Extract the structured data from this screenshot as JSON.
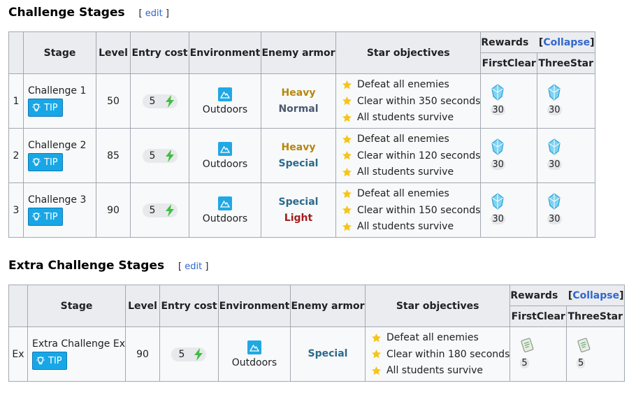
{
  "section1": {
    "title": "Challenge Stages",
    "edit_open": "[",
    "edit_label": "edit",
    "edit_close": "]",
    "headers": {
      "stage": "Stage",
      "level": "Level",
      "entry_cost": "Entry cost",
      "environment": "Environment",
      "enemy_armor": "Enemy armor",
      "star_objectives": "Star objectives",
      "rewards": "Rewards",
      "collapse_open": "[",
      "collapse": "Collapse",
      "collapse_close": "]",
      "first_clear": "FirstClear",
      "three_star": "ThreeStar"
    },
    "rows": [
      {
        "num": "1",
        "name": "Challenge 1",
        "tip": "TIP",
        "level": "50",
        "cost": "5",
        "environment": "Outdoors",
        "armor1": "Heavy",
        "armor2": "Normal",
        "objectives": [
          "Defeat all enemies",
          "Clear within 350 seconds",
          "All students survive"
        ],
        "first_clear": "30",
        "three_star": "30"
      },
      {
        "num": "2",
        "name": "Challenge 2",
        "tip": "TIP",
        "level": "85",
        "cost": "5",
        "environment": "Outdoors",
        "armor1": "Heavy",
        "armor2": "Special",
        "objectives": [
          "Defeat all enemies",
          "Clear within 120 seconds",
          "All students survive"
        ],
        "first_clear": "30",
        "three_star": "30"
      },
      {
        "num": "3",
        "name": "Challenge 3",
        "tip": "TIP",
        "level": "90",
        "cost": "5",
        "environment": "Outdoors",
        "armor1": "Special",
        "armor2": "Light",
        "objectives": [
          "Defeat all enemies",
          "Clear within 150 seconds",
          "All students survive"
        ],
        "first_clear": "30",
        "three_star": "30"
      }
    ]
  },
  "section2": {
    "title": "Extra Challenge Stages",
    "edit_open": "[",
    "edit_label": "edit",
    "edit_close": "]",
    "headers": {
      "stage": "Stage",
      "level": "Level",
      "entry_cost": "Entry cost",
      "environment": "Environment",
      "enemy_armor": "Enemy armor",
      "star_objectives": "Star objectives",
      "rewards": "Rewards",
      "collapse_open": "[",
      "collapse": "Collapse",
      "collapse_close": "]",
      "first_clear": "FirstClear",
      "three_star": "ThreeStar"
    },
    "rows": [
      {
        "num": "Ex",
        "name": "Extra Challenge Ex",
        "tip": "TIP",
        "level": "90",
        "cost": "5",
        "environment": "Outdoors",
        "armor1": "Special",
        "objectives": [
          "Defeat all enemies",
          "Clear within 180 seconds",
          "All students survive"
        ],
        "first_clear": "5",
        "three_star": "5"
      }
    ]
  },
  "icons": {
    "tip": "lightbulb-icon",
    "cost": "lightning-icon",
    "environment": "mountain-icon",
    "objective": "star-icon",
    "reward_pyroxene": "crystal-icon",
    "reward_ticket": "ticket-icon"
  },
  "colors": {
    "link": "#3366cc",
    "tip_bg": "#18a7e6",
    "header_bg": "#eaecf0",
    "cell_bg": "#f8f9fa",
    "border": "#a2a9b1",
    "star": "#f5c518",
    "lightning": "#3fbf3f",
    "heavy": "#b8860b",
    "normal": "#4c5870",
    "special": "#2a6a8c",
    "light": "#a31c1c"
  }
}
